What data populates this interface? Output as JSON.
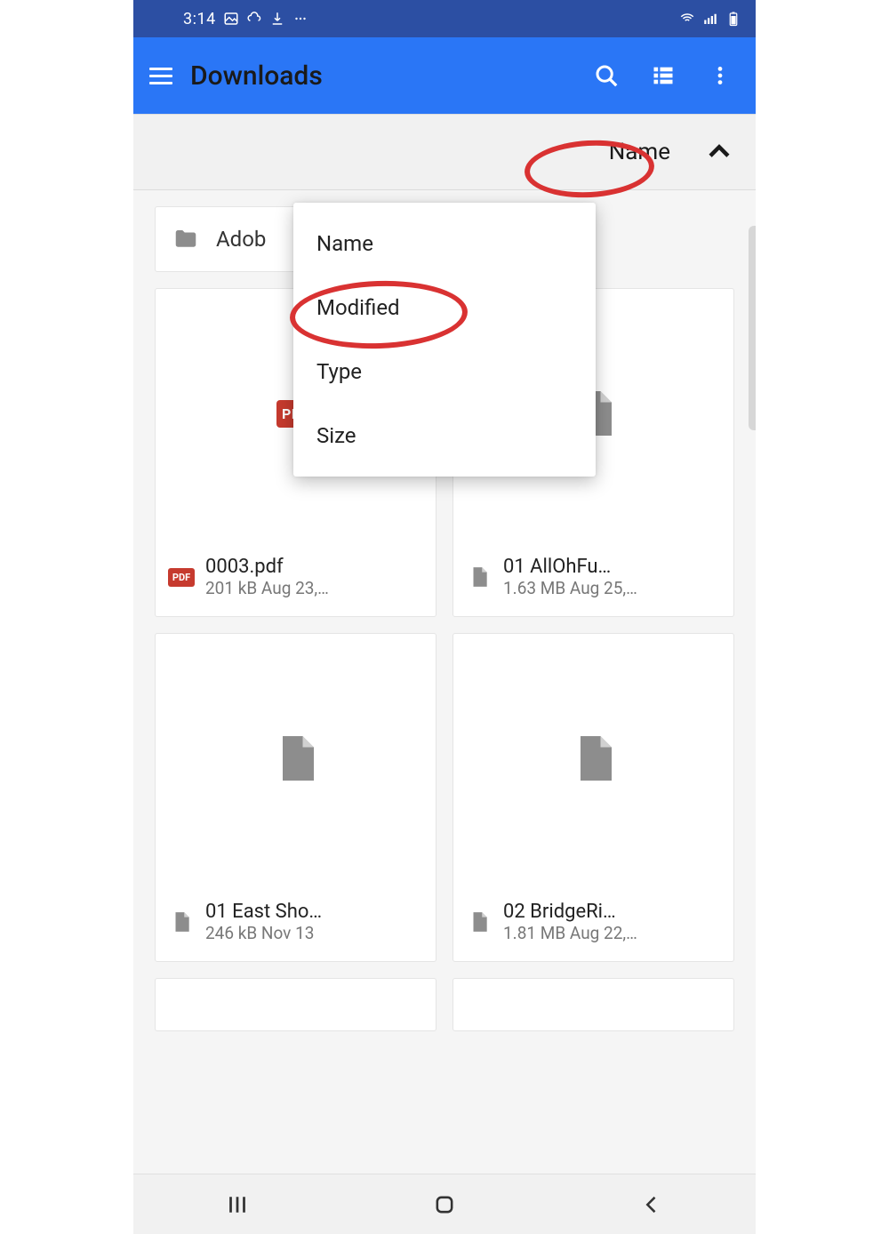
{
  "status": {
    "time": "3:14"
  },
  "appbar": {
    "title": "Downloads"
  },
  "sort": {
    "current": "Name",
    "options": [
      "Name",
      "Modified",
      "Type",
      "Size"
    ]
  },
  "folder": {
    "name": "Adob"
  },
  "files": [
    {
      "name": "0003.pdf",
      "meta": "201 kB Aug 23,…",
      "kind": "pdf"
    },
    {
      "name": "01 AllOhFu…",
      "meta": "1.63 MB Aug 25,…",
      "kind": "file"
    },
    {
      "name": "01 East Sho…",
      "meta": "246 kB Nov 13",
      "kind": "file"
    },
    {
      "name": "02 BridgeRi…",
      "meta": "1.81 MB Aug 22,…",
      "kind": "file"
    }
  ],
  "annotations": {
    "circled_sort_label": true,
    "circled_menu_item": "Modified"
  },
  "pdf_badge": "PDF"
}
